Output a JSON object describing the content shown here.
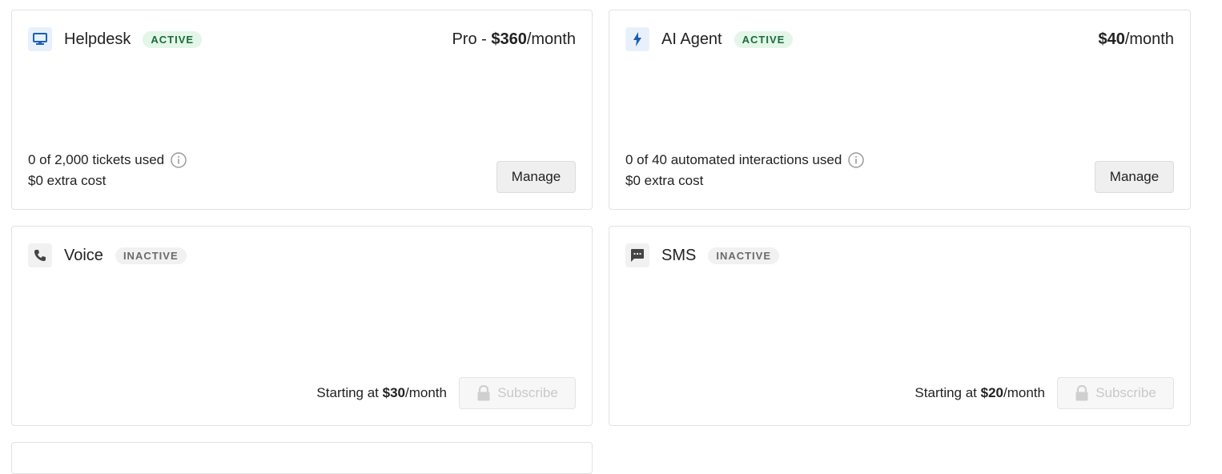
{
  "colors": {
    "accent_blue": "#1a73e8",
    "active_badge_bg": "#e3f6e8",
    "active_badge_text": "#1b6b3a",
    "inactive_badge_bg": "#f1f1f1",
    "inactive_badge_text": "#6a6a6a"
  },
  "cards": {
    "helpdesk": {
      "icon": "monitor-icon",
      "name": "Helpdesk",
      "status": "ACTIVE",
      "price_prefix": "Pro - ",
      "price_amount": "$360",
      "price_suffix": "/month",
      "usage": "0 of 2,000 tickets used",
      "extra_cost": "$0 extra cost",
      "button": "Manage"
    },
    "ai_agent": {
      "icon": "bolt-icon",
      "name": "AI Agent",
      "status": "ACTIVE",
      "price_amount": "$40",
      "price_suffix": "/month",
      "usage": "0 of 40 automated interactions used",
      "extra_cost": "$0 extra cost",
      "button": "Manage"
    },
    "voice": {
      "icon": "phone-icon",
      "name": "Voice",
      "status": "INACTIVE",
      "starting_prefix": "Starting at ",
      "starting_amount": "$30",
      "starting_suffix": "/month",
      "button": "Subscribe"
    },
    "sms": {
      "icon": "chat-icon",
      "name": "SMS",
      "status": "INACTIVE",
      "starting_prefix": "Starting at ",
      "starting_amount": "$20",
      "starting_suffix": "/month",
      "button": "Subscribe"
    }
  }
}
